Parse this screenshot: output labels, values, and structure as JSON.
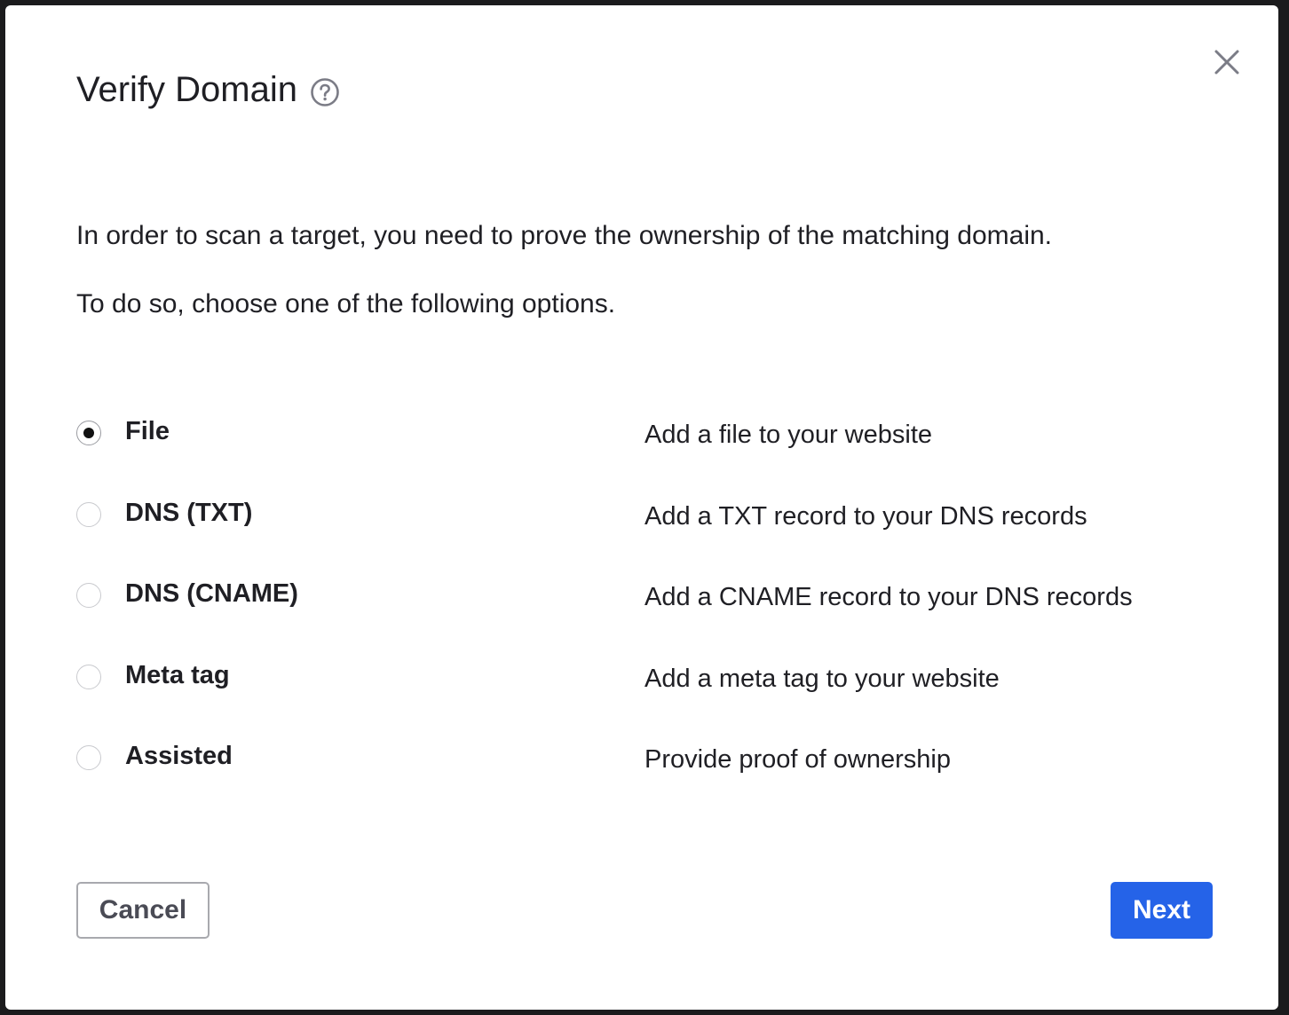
{
  "dialog": {
    "title": "Verify Domain",
    "help_icon": "question-circle-icon",
    "close_icon": "close-x-icon"
  },
  "intro": {
    "line1": "In order to scan a target, you need to prove the ownership of the matching domain.",
    "line2": "To do so, choose one of the following options."
  },
  "options": [
    {
      "label": "File",
      "description": "Add a file to your website",
      "selected": true
    },
    {
      "label": "DNS (TXT)",
      "description": "Add a TXT record to your DNS records",
      "selected": false
    },
    {
      "label": "DNS (CNAME)",
      "description": "Add a CNAME record to your DNS records",
      "selected": false
    },
    {
      "label": "Meta tag",
      "description": "Add a meta tag to your website",
      "selected": false
    },
    {
      "label": "Assisted",
      "description": "Provide proof of ownership",
      "selected": false
    }
  ],
  "footer": {
    "cancel_label": "Cancel",
    "next_label": "Next"
  },
  "colors": {
    "accent": "#2563e8",
    "text": "#1f1f24",
    "icon_gray": "#7b7c86"
  }
}
